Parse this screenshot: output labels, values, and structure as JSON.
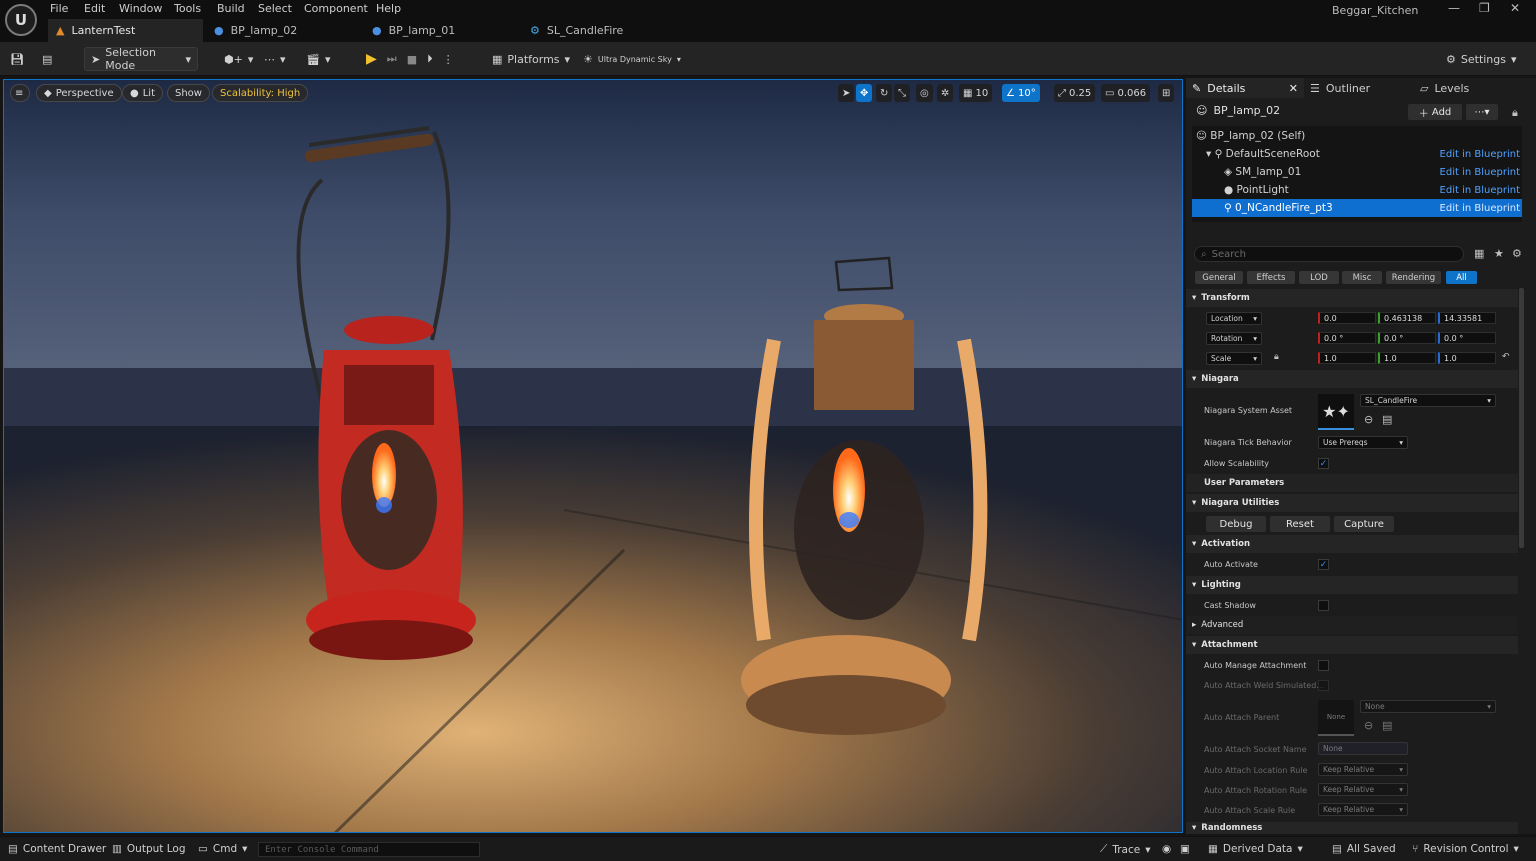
{
  "menu": {
    "items": [
      "File",
      "Edit",
      "Window",
      "Tools",
      "Build",
      "Select",
      "Component",
      "Help"
    ]
  },
  "tabs": [
    {
      "label": "LanternTest",
      "icon": "level-icon"
    },
    {
      "label": "BP_lamp_02",
      "icon": "blueprint-icon"
    },
    {
      "label": "BP_lamp_01",
      "icon": "blueprint-icon"
    },
    {
      "label": "SL_CandleFire",
      "icon": "niagara-icon"
    }
  ],
  "project_name": "Beggar_Kitchen",
  "toolbar": {
    "selection_mode": "Selection Mode",
    "platforms": "Platforms",
    "sky": "Ultra Dynamic Sky",
    "settings": "Settings"
  },
  "viewport": {
    "perspective": "Perspective",
    "lit": "Lit",
    "show": "Show",
    "scalability": "Scalability: High",
    "grid_snap": "10",
    "angle_snap": "10°",
    "scale_snap": "0.25",
    "camera_speed": "0.066"
  },
  "panel": {
    "tabs": {
      "details": "Details",
      "outliner": "Outliner",
      "levels": "Levels"
    },
    "actor_name": "BP_lamp_02",
    "add_label": "Add",
    "tree": [
      {
        "label": "BP_lamp_02 (Self)",
        "link": ""
      },
      {
        "label": "DefaultSceneRoot",
        "link": "Edit in Blueprint"
      },
      {
        "label": "SM_lamp_01",
        "link": "Edit in Blueprint"
      },
      {
        "label": "PointLight",
        "link": "Edit in Blueprint"
      },
      {
        "label": "0_NCandleFire_pt3",
        "link": "Edit in Blueprint"
      }
    ],
    "search_placeholder": "Search",
    "filters": [
      "General",
      "Effects",
      "LOD",
      "Misc",
      "Rendering",
      "All"
    ],
    "sections": {
      "transform": "Transform",
      "niagara": "Niagara",
      "user_params": "User Parameters",
      "utilities": "Niagara Utilities",
      "activation": "Activation",
      "lighting": "Lighting",
      "advanced": "Advanced",
      "attachment": "Attachment",
      "randomness": "Randomness"
    },
    "transform": {
      "location_label": "Location",
      "rotation_label": "Rotation",
      "scale_label": "Scale",
      "location": [
        "0.0",
        "0.463138",
        "14.33581"
      ],
      "rotation": [
        "0.0 °",
        "0.0 °",
        "0.0 °"
      ],
      "scale": [
        "1.0",
        "1.0",
        "1.0"
      ]
    },
    "niagara": {
      "system_asset_label": "Niagara System Asset",
      "system_asset": "SL_CandleFire",
      "tick_label": "Niagara Tick Behavior",
      "tick_value": "Use Prereqs",
      "allow_scal_label": "Allow Scalability"
    },
    "utilities": {
      "debug": "Debug",
      "reset": "Reset",
      "capture": "Capture"
    },
    "auto_activate_label": "Auto Activate",
    "cast_shadow_label": "Cast Shadow",
    "attachment": {
      "auto_manage": "Auto Manage Attachment",
      "weld": "Auto Attach Weld Simulated...",
      "parent_label": "Auto Attach Parent",
      "parent_thumb": "None",
      "parent_value": "None",
      "socket_label": "Auto Attach Socket Name",
      "socket_value": "None",
      "loc_rule_label": "Auto Attach Location Rule",
      "rot_rule_label": "Auto Attach Rotation Rule",
      "scale_rule_label": "Auto Attach Scale Rule",
      "rule_value": "Keep Relative"
    }
  },
  "statusbar": {
    "content_drawer": "Content Drawer",
    "output_log": "Output Log",
    "cmd": "Cmd",
    "console_placeholder": "Enter Console Command",
    "trace": "Trace",
    "derived_data": "Derived Data",
    "all_saved": "All Saved",
    "revision": "Revision Control"
  },
  "colors": {
    "accent": "#0e74c9",
    "link": "#4fa1ff",
    "warning": "#f0c23a",
    "play": "#f2c12e"
  }
}
